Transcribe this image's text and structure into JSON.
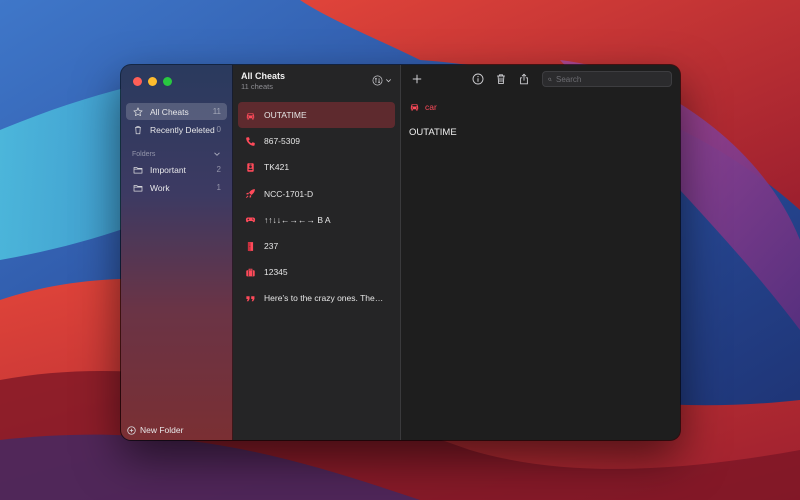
{
  "colors": {
    "accent": "#ff4a5a",
    "selected_row": "#5e2a2e"
  },
  "sidebar": {
    "items": [
      {
        "label": "All Cheats",
        "count": "11",
        "icon": "star-icon"
      },
      {
        "label": "Recently Deleted",
        "count": "0",
        "icon": "trash-icon"
      }
    ],
    "folders_header": "Folders",
    "folders": [
      {
        "label": "Important",
        "count": "2",
        "icon": "folder-icon"
      },
      {
        "label": "Work",
        "count": "1",
        "icon": "folder-icon"
      }
    ],
    "new_folder_label": "New Folder"
  },
  "list": {
    "title": "All Cheats",
    "subtitle": "11 cheats",
    "rows": [
      {
        "label": "OUTATIME",
        "icon": "car-icon"
      },
      {
        "label": "867-5309",
        "icon": "phone-icon"
      },
      {
        "label": "TK421",
        "icon": "id-badge-icon"
      },
      {
        "label": "NCC-1701-D",
        "icon": "rocket-icon"
      },
      {
        "label": "↑↑↓↓←→←→ B A",
        "icon": "gamepad-icon"
      },
      {
        "label": "237",
        "icon": "door-icon"
      },
      {
        "label": "12345",
        "icon": "suitcase-icon"
      },
      {
        "label": "Here’s to the crazy ones. The…",
        "icon": "quote-icon"
      }
    ]
  },
  "detail": {
    "search_placeholder": "Search",
    "tag_label": "car",
    "tag_icon": "car-icon",
    "value": "OUTATIME"
  }
}
